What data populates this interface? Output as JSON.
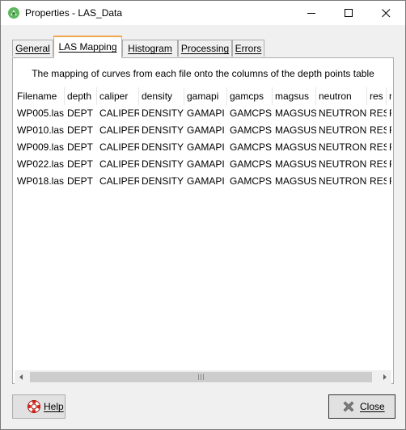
{
  "window": {
    "title": "Properties - LAS_Data"
  },
  "tabs": [
    {
      "label": "General",
      "active": false
    },
    {
      "label": "LAS Mapping",
      "active": true
    },
    {
      "label": "Histogram",
      "active": false
    },
    {
      "label": "Processing",
      "active": false
    },
    {
      "label": "Errors",
      "active": false
    }
  ],
  "description": "The mapping of curves from each file onto the columns of the depth points table",
  "table": {
    "columns": [
      "Filename",
      "depth",
      "caliper",
      "density",
      "gamapi",
      "gamcps",
      "magsus",
      "neutron",
      "res",
      "r"
    ],
    "rows": [
      [
        "WP005.las",
        "DEPT",
        "CALIPER",
        "DENSITY",
        "GAMAPI",
        "GAMCPS",
        "MAGSUS",
        "NEUTRON",
        "RES",
        "R"
      ],
      [
        "WP010.las",
        "DEPT",
        "CALIPER",
        "DENSITY",
        "GAMAPI",
        "GAMCPS",
        "MAGSUS",
        "NEUTRON",
        "RES",
        "R"
      ],
      [
        "WP009.las",
        "DEPT",
        "CALIPER",
        "DENSITY",
        "GAMAPI",
        "GAMCPS",
        "MAGSUS",
        "NEUTRON",
        "RES",
        "R"
      ],
      [
        "WP022.las",
        "DEPT",
        "CALIPER",
        "DENSITY",
        "GAMAPI",
        "GAMCPS",
        "MAGSUS",
        "NEUTRON",
        "RES",
        "R"
      ],
      [
        "WP018.las",
        "DEPT",
        "CALIPER",
        "DENSITY",
        "GAMAPI",
        "GAMCPS",
        "MAGSUS",
        "NEUTRON",
        "RES",
        "R"
      ]
    ]
  },
  "buttons": {
    "help": "Help",
    "close": "Close"
  },
  "icons": {
    "app": "leapfrog-app-icon",
    "help": "lifebuoy-icon",
    "close": "x-close-icon"
  },
  "colors": {
    "active_tab_border": "#f0a64c",
    "help_icon": "#d9261c",
    "close_icon": "#7a7a7a",
    "app_icon": "#4caf50"
  }
}
